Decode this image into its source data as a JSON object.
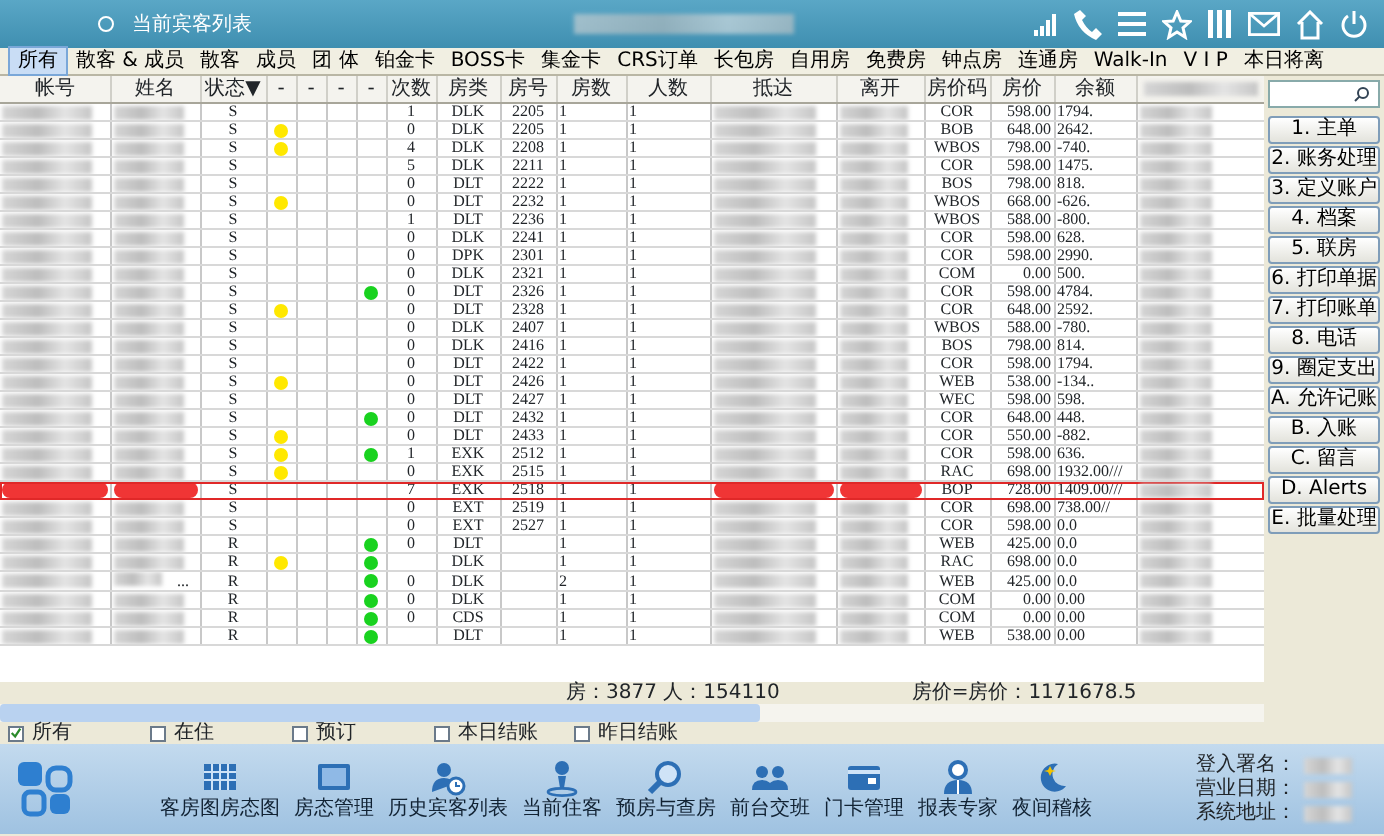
{
  "window": {
    "title": "当前宾客列表"
  },
  "tabs": [
    {
      "label": "所有",
      "selected": true
    },
    {
      "label": "散客 & 成员",
      "selected": false
    },
    {
      "label": "散客",
      "selected": false
    },
    {
      "label": "成员",
      "selected": false
    },
    {
      "label": "团 体",
      "selected": false
    },
    {
      "label": "铂金卡",
      "selected": false
    },
    {
      "label": "BOSS卡",
      "selected": false
    },
    {
      "label": "集金卡",
      "selected": false
    },
    {
      "label": "CRS订单",
      "selected": false
    },
    {
      "label": "长包房",
      "selected": false
    },
    {
      "label": "自用房",
      "selected": false
    },
    {
      "label": "免费房",
      "selected": false
    },
    {
      "label": "钟点房",
      "selected": false
    },
    {
      "label": "连通房",
      "selected": false
    },
    {
      "label": "Walk-In",
      "selected": false
    },
    {
      "label": "V I P",
      "selected": false
    },
    {
      "label": "本日将离",
      "selected": false
    }
  ],
  "table": {
    "columns": [
      "帐号",
      "姓名",
      "状态▼",
      "-",
      "-",
      "-",
      "-",
      "次数",
      "房类",
      "房号",
      "房数",
      "人数",
      "抵达",
      "离开",
      "房价码",
      "房价",
      "余额"
    ],
    "rows": [
      {
        "status": "S",
        "dot_column_2": false,
        "dot_column_5": false,
        "visits": "1",
        "room_type": "DLK",
        "room_no": "2205",
        "rooms": "1",
        "guests": "1",
        "rate_code": "COR",
        "rate": "598.00",
        "balance": "1794.",
        "flagged": false
      },
      {
        "status": "S",
        "dot_column_2": true,
        "dot_column_5": false,
        "visits": "0",
        "room_type": "DLK",
        "room_no": "2205",
        "rooms": "1",
        "guests": "1",
        "rate_code": "BOB",
        "rate": "648.00",
        "balance": "2642.",
        "flagged": false
      },
      {
        "status": "S",
        "dot_column_2": true,
        "dot_column_5": false,
        "visits": "4",
        "room_type": "DLK",
        "room_no": "2208",
        "rooms": "1",
        "guests": "1",
        "rate_code": "WBOS",
        "rate": "798.00",
        "balance": "-740.",
        "flagged": false
      },
      {
        "status": "S",
        "dot_column_2": false,
        "dot_column_5": false,
        "visits": "5",
        "room_type": "DLK",
        "room_no": "2211",
        "rooms": "1",
        "guests": "1",
        "rate_code": "COR",
        "rate": "598.00",
        "balance": "1475.",
        "flagged": false
      },
      {
        "status": "S",
        "dot_column_2": false,
        "dot_column_5": false,
        "visits": "0",
        "room_type": "DLT",
        "room_no": "2222",
        "rooms": "1",
        "guests": "1",
        "rate_code": "BOS",
        "rate": "798.00",
        "balance": "818.",
        "flagged": false
      },
      {
        "status": "S",
        "dot_column_2": true,
        "dot_column_5": false,
        "visits": "0",
        "room_type": "DLT",
        "room_no": "2232",
        "rooms": "1",
        "guests": "1",
        "rate_code": "WBOS",
        "rate": "668.00",
        "balance": "-626.",
        "flagged": false
      },
      {
        "status": "S",
        "dot_column_2": false,
        "dot_column_5": false,
        "visits": "1",
        "room_type": "DLT",
        "room_no": "2236",
        "rooms": "1",
        "guests": "1",
        "rate_code": "WBOS",
        "rate": "588.00",
        "balance": "-800.",
        "flagged": false
      },
      {
        "status": "S",
        "dot_column_2": false,
        "dot_column_5": false,
        "visits": "0",
        "room_type": "DLK",
        "room_no": "2241",
        "rooms": "1",
        "guests": "1",
        "rate_code": "COR",
        "rate": "598.00",
        "balance": "628.",
        "flagged": false
      },
      {
        "status": "S",
        "dot_column_2": false,
        "dot_column_5": false,
        "visits": "0",
        "room_type": "DPK",
        "room_no": "2301",
        "rooms": "1",
        "guests": "1",
        "rate_code": "COR",
        "rate": "598.00",
        "balance": "2990.",
        "flagged": false
      },
      {
        "status": "S",
        "dot_column_2": false,
        "dot_column_5": false,
        "visits": "0",
        "room_type": "DLK",
        "room_no": "2321",
        "rooms": "1",
        "guests": "1",
        "rate_code": "COM",
        "rate": "0.00",
        "balance": "500.",
        "flagged": false
      },
      {
        "status": "S",
        "dot_column_2": false,
        "dot_column_5": true,
        "visits": "0",
        "room_type": "DLT",
        "room_no": "2326",
        "rooms": "1",
        "guests": "1",
        "rate_code": "COR",
        "rate": "598.00",
        "balance": "4784.",
        "flagged": false
      },
      {
        "status": "S",
        "dot_column_2": true,
        "dot_column_5": false,
        "visits": "0",
        "room_type": "DLT",
        "room_no": "2328",
        "rooms": "1",
        "guests": "1",
        "rate_code": "COR",
        "rate": "648.00",
        "balance": "2592.",
        "flagged": false
      },
      {
        "status": "S",
        "dot_column_2": false,
        "dot_column_5": false,
        "visits": "0",
        "room_type": "DLK",
        "room_no": "2407",
        "rooms": "1",
        "guests": "1",
        "rate_code": "WBOS",
        "rate": "588.00",
        "balance": "-780.",
        "flagged": false
      },
      {
        "status": "S",
        "dot_column_2": false,
        "dot_column_5": false,
        "visits": "0",
        "room_type": "DLK",
        "room_no": "2416",
        "rooms": "1",
        "guests": "1",
        "rate_code": "BOS",
        "rate": "798.00",
        "balance": "814.",
        "flagged": false
      },
      {
        "status": "S",
        "dot_column_2": false,
        "dot_column_5": false,
        "visits": "0",
        "room_type": "DLT",
        "room_no": "2422",
        "rooms": "1",
        "guests": "1",
        "rate_code": "COR",
        "rate": "598.00",
        "balance": "1794.",
        "flagged": false
      },
      {
        "status": "S",
        "dot_column_2": true,
        "dot_column_5": false,
        "visits": "0",
        "room_type": "DLT",
        "room_no": "2426",
        "rooms": "1",
        "guests": "1",
        "rate_code": "WEB",
        "rate": "538.00",
        "balance": "-134..",
        "flagged": false
      },
      {
        "status": "S",
        "dot_column_2": false,
        "dot_column_5": false,
        "visits": "0",
        "room_type": "DLT",
        "room_no": "2427",
        "rooms": "1",
        "guests": "1",
        "rate_code": "WEC",
        "rate": "598.00",
        "balance": "598.",
        "flagged": false
      },
      {
        "status": "S",
        "dot_column_2": false,
        "dot_column_5": true,
        "visits": "0",
        "room_type": "DLT",
        "room_no": "2432",
        "rooms": "1",
        "guests": "1",
        "rate_code": "COR",
        "rate": "648.00",
        "balance": "448.",
        "flagged": false
      },
      {
        "status": "S",
        "dot_column_2": true,
        "dot_column_5": false,
        "visits": "0",
        "room_type": "DLT",
        "room_no": "2433",
        "rooms": "1",
        "guests": "1",
        "rate_code": "COR",
        "rate": "550.00",
        "balance": "-882.",
        "flagged": false
      },
      {
        "status": "S",
        "dot_column_2": true,
        "dot_column_5": true,
        "visits": "1",
        "room_type": "EXK",
        "room_no": "2512",
        "rooms": "1",
        "guests": "1",
        "rate_code": "COR",
        "rate": "598.00",
        "balance": "636.",
        "flagged": false
      },
      {
        "status": "S",
        "dot_column_2": true,
        "dot_column_5": false,
        "visits": "0",
        "room_type": "EXK",
        "room_no": "2515",
        "rooms": "1",
        "guests": "1",
        "rate_code": "RAC",
        "rate": "698.00",
        "balance": "1932.00///",
        "flagged": false
      },
      {
        "status": "S",
        "dot_column_2": false,
        "dot_column_5": false,
        "visits": "7",
        "room_type": "EXK",
        "room_no": "2518",
        "rooms": "1",
        "guests": "1",
        "rate_code": "BOP",
        "rate": "728.00",
        "balance": "1409.00///",
        "flagged": true
      },
      {
        "status": "S",
        "dot_column_2": false,
        "dot_column_5": false,
        "visits": "0",
        "room_type": "EXT",
        "room_no": "2519",
        "rooms": "1",
        "guests": "1",
        "rate_code": "COR",
        "rate": "698.00",
        "balance": "738.00//",
        "flagged": false
      },
      {
        "status": "S",
        "dot_column_2": false,
        "dot_column_5": false,
        "visits": "0",
        "room_type": "EXT",
        "room_no": "2527",
        "rooms": "1",
        "guests": "1",
        "rate_code": "COR",
        "rate": "598.00",
        "balance": "0.0",
        "flagged": false
      },
      {
        "status": "R",
        "dot_column_2": false,
        "dot_column_5": true,
        "visits": "0",
        "room_type": "DLT",
        "rooms": "1",
        "guests": "1",
        "rate_code": "WEB",
        "rate": "425.00",
        "balance": "0.0",
        "flagged": false
      },
      {
        "status": "R",
        "dot_column_2": true,
        "dot_column_5": true,
        "room_type": "DLK",
        "rooms": "1",
        "guests": "1",
        "rate_code": "RAC",
        "rate": "698.00",
        "balance": "0.0",
        "flagged": false
      },
      {
        "status": "R",
        "name_note": "...",
        "dot_column_2": false,
        "dot_column_5": true,
        "visits": "0",
        "room_type": "DLK",
        "rooms": "2",
        "guests": "1",
        "rate_code": "WEB",
        "rate": "425.00",
        "balance": "0.0",
        "flagged": false
      },
      {
        "status": "R",
        "dot_column_2": false,
        "dot_column_5": true,
        "visits": "0",
        "room_type": "DLK",
        "rooms": "1",
        "guests": "1",
        "rate_code": "COM",
        "rate": "0.00",
        "balance": "0.00",
        "flagged": false
      },
      {
        "status": "R",
        "dot_column_2": false,
        "dot_column_5": true,
        "visits": "0",
        "room_type": "CDS",
        "rooms": "1",
        "guests": "1",
        "rate_code": "COM",
        "rate": "0.00",
        "balance": "0.00",
        "flagged": false
      },
      {
        "status": "R",
        "dot_column_2": false,
        "dot_column_5": true,
        "room_type": "DLT",
        "rooms": "1",
        "guests": "1",
        "rate_code": "WEB",
        "rate": "538.00",
        "balance": "0.00",
        "flagged": false
      }
    ]
  },
  "summary": {
    "rooms_guests": "房：3877 人：154110",
    "rate_total": "房价=房价：1171678.5"
  },
  "side_panel": {
    "buttons": [
      "1. 主单",
      "2. 账务处理",
      "3. 定义账户",
      "4. 档案",
      "5. 联房",
      "6. 打印单据",
      "7. 打印账单",
      "8. 电话",
      "9. 圈定支出",
      "A. 允许记账",
      "B. 入账",
      "C. 留言",
      "D. Alerts",
      "E. 批量处理"
    ]
  },
  "filters": [
    {
      "label": "所有",
      "checked": true
    },
    {
      "label": "在住",
      "checked": false
    },
    {
      "label": "预订",
      "checked": false
    },
    {
      "label": "本日结账",
      "checked": false
    },
    {
      "label": "昨日结账",
      "checked": false
    }
  ],
  "toolbar": [
    "客房图房态图",
    "房态管理",
    "历史宾客列表",
    "当前住客",
    "预房与查房",
    "前台交班",
    "门卡管理",
    "报表专家",
    "夜间稽核"
  ],
  "login_info": [
    "登入署名：",
    "营业日期：",
    "系统地址："
  ]
}
